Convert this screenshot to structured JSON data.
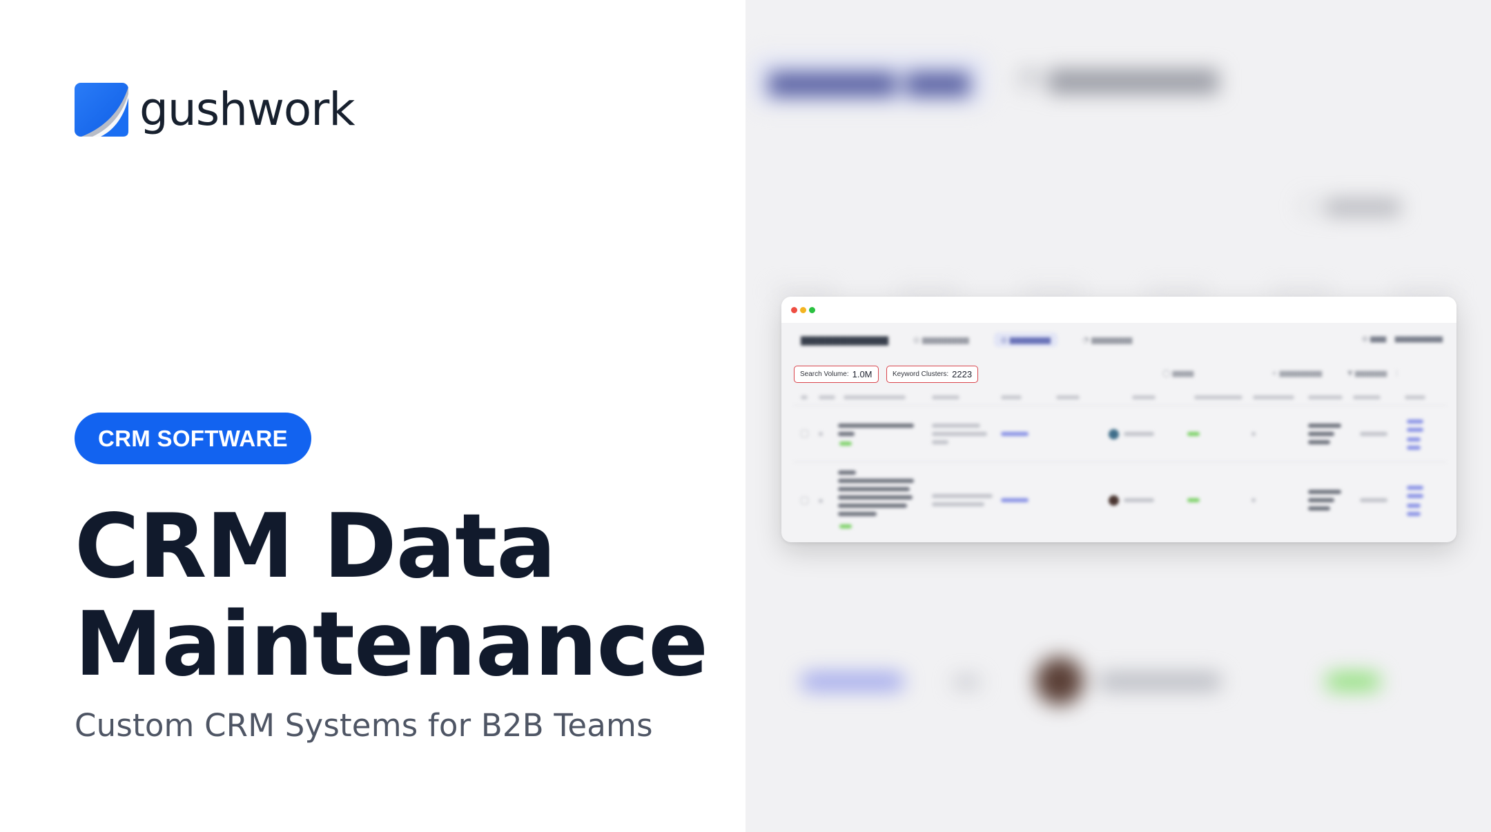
{
  "brand": {
    "name": "gushwork",
    "logo_color": "#1a6ef2"
  },
  "category": {
    "label": "CRM SOFTWARE",
    "color": "#1263f0"
  },
  "headline": {
    "line1": "CRM Data",
    "line2": "Maintenance"
  },
  "subtitle": "Custom CRM Systems for B2B Teams",
  "preview": {
    "filters": [
      {
        "label": "Search Volume:",
        "value": "1.0M"
      },
      {
        "label": "Keyword Clusters:",
        "value": "2223"
      }
    ],
    "highlight_color": "#d9434b"
  }
}
